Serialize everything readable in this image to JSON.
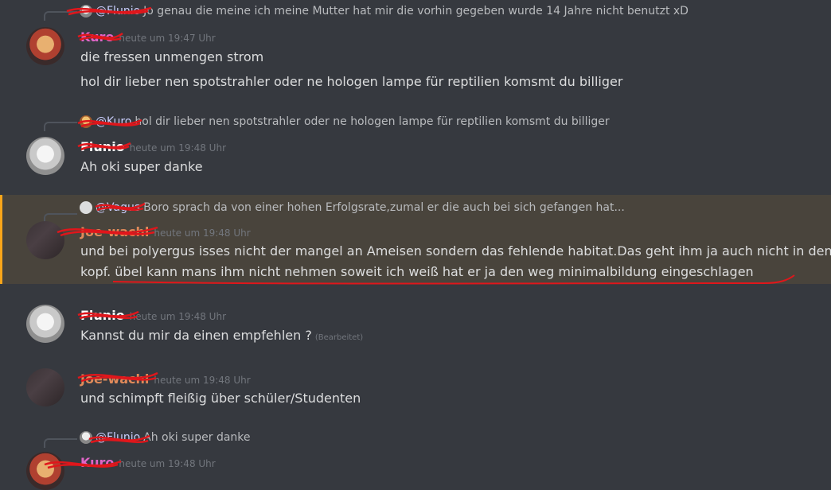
{
  "messages": [
    {
      "reply": {
        "author": "@Flunio",
        "text": "Jo genau die meine ich meine Mutter hat mir die vorhin gegeben wurde 14 Jahre nicht benutzt xD",
        "avatar_icon": "flunio-avatar"
      },
      "author": "Kuro",
      "timestamp": "heute um 19:47 Uhr",
      "lines": [
        "die fressen unmengen strom",
        "hol dir  lieber nen spotstrahler oder ne hologen lampe für reptilien komsmt du billiger"
      ]
    },
    {
      "reply": {
        "author": "@Kuro",
        "text": "hol dir  lieber nen spotstrahler oder ne hologen lampe für reptilien komsmt du billiger",
        "avatar_icon": "kuro-avatar"
      },
      "author": "Flunio",
      "timestamp": "heute um 19:48 Uhr",
      "lines": [
        "Ah oki super danke"
      ]
    },
    {
      "reply": {
        "author": "@Vagus",
        "text": "Boro sprach da von einer hohen Erfolgsrate,zumal er die auch bei sich gefangen hat...",
        "avatar_icon": "bot-avatar"
      },
      "author": "Joe-wachl",
      "timestamp": "heute um 19:48 Uhr",
      "lines": [
        "und bei polyergus isses nicht der mangel an Ameisen sondern das fehlende habitat.Das geht ihm ja auch nicht in den",
        "kopf. übel kann mans ihm nicht nehmen soweit ich weiß hat er ja den weg minimalbildung eingeschlagen"
      ]
    },
    {
      "author": "Flunio",
      "timestamp": "heute um 19:48 Uhr",
      "lines": [
        "Kannst du mir da einen empfehlen ?"
      ],
      "edited": "(Bearbeitet)"
    },
    {
      "author": "Joe-wachl",
      "timestamp": "heute um 19:48 Uhr",
      "lines": [
        "und schimpft fleißig über schüler/Studenten"
      ]
    },
    {
      "reply": {
        "author": "@Flunio",
        "text": "Ah oki super danke",
        "avatar_icon": "flunio-avatar"
      },
      "author": "Kuro",
      "timestamp": "heute um 19:48 Uhr",
      "lines": []
    }
  ],
  "colors": {
    "background": "#36393f",
    "mention_background": "#49443c",
    "mention_border": "#faa61a",
    "scribble": "#e0161b"
  }
}
